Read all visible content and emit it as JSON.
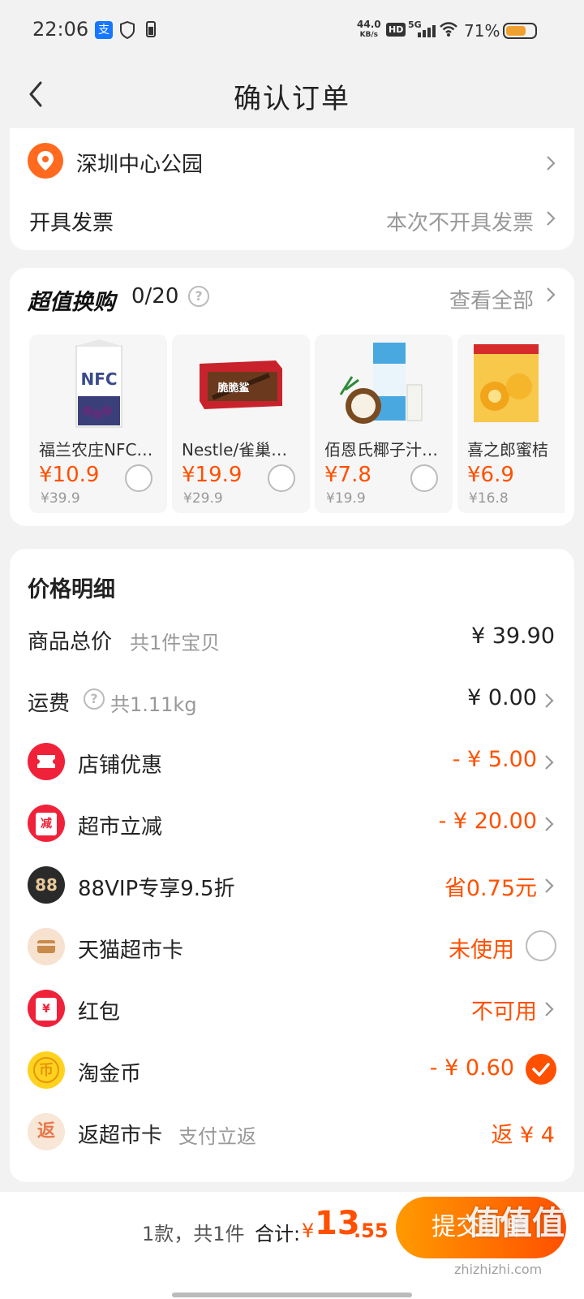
{
  "status_bar": {
    "time": "22:06",
    "alipay_icon_text": "支",
    "speed_value": "44.0",
    "speed_unit": "KB/s",
    "hd_label": "HD",
    "network": "5G",
    "battery_percent": "71%",
    "battery_level": 0.71
  },
  "header": {
    "title": "确认订单"
  },
  "address": {
    "text": "深圳中心公园"
  },
  "invoice": {
    "label": "开具发票",
    "value": "本次不开具发票"
  },
  "deals": {
    "title": "超值换购",
    "count": "0/20",
    "help_symbol": "?",
    "view_all": "查看全部",
    "items": [
      {
        "name": "福兰农庄NFC…",
        "price": "¥10.9",
        "original": "¥39.9",
        "img_text": "NFC",
        "selected": false
      },
      {
        "name": "Nestle/雀巢…",
        "price": "¥19.9",
        "original": "¥29.9",
        "img_text": "脆脆鲨",
        "selected": false
      },
      {
        "name": "佰恩氏椰子汁…",
        "price": "¥7.8",
        "original": "¥19.9",
        "img_text": "",
        "selected": false
      },
      {
        "name": "喜之郎蜜桔",
        "price": "¥6.9",
        "original": "¥16.8",
        "img_text": "",
        "selected": false
      }
    ]
  },
  "price_detail": {
    "heading": "价格明细",
    "rows": [
      {
        "label": "商品总价",
        "sub": "共1件宝贝",
        "value": "¥ 39.90"
      },
      {
        "label": "运费",
        "sub": "共1.11kg",
        "help_symbol": "?",
        "value": "¥ 0.00"
      },
      {
        "label": "店铺优惠",
        "value": "- ¥ 5.00"
      },
      {
        "label": "超市立减",
        "icon_text": "减",
        "value": "- ¥ 20.00"
      },
      {
        "label": "88VIP专享9.5折",
        "icon_text": "88",
        "value": "省0.75元"
      },
      {
        "label": "天猫超市卡",
        "value": "未使用",
        "checked": false
      },
      {
        "label": "红包",
        "icon_text": "¥",
        "value": "不可用"
      },
      {
        "label": "淘金币",
        "icon_text": "币",
        "value": "- ¥ 0.60",
        "checked": true
      },
      {
        "label": "返超市卡",
        "icon_text": "返",
        "sub": "支付立返",
        "value": "返 ¥ 4"
      }
    ]
  },
  "bottom_bar": {
    "count_text": "1款，共1件",
    "total_label": "合计:",
    "currency": "¥",
    "total_int": "13",
    "total_dec": ".55",
    "submit_label": "提交订单",
    "watermark": "值值值",
    "watermark_sub": "zhizhizhi.com"
  },
  "colors": {
    "accent": "#ff5000",
    "accent_gradient_start": "#ff9a00",
    "muted_text": "#999999",
    "background": "#f2f2f2"
  }
}
